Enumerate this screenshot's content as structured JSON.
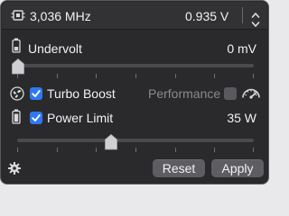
{
  "header": {
    "frequency": "3,036 MHz",
    "voltage": "0.935 V",
    "icons": [
      "cpu-chip-icon",
      "chevron-up-icon",
      "chevron-down-icon"
    ]
  },
  "undervolt": {
    "label": "Undervolt",
    "value": "0 mV",
    "icon": "battery-icon",
    "slider_level": 0.0
  },
  "turbo": {
    "label": "Turbo Boost",
    "checked": true,
    "mode_label": "Performance",
    "mode_checked": false,
    "icons": [
      "turbo-fan-icon",
      "speedometer-icon"
    ]
  },
  "power": {
    "label": "Power Limit",
    "value": "35 W",
    "checked": true,
    "icon": "battery-icon",
    "slider_level": 0.4
  },
  "footer": {
    "reset_label": "Reset",
    "apply_label": "Apply",
    "settings_icon": "gear-icon"
  },
  "colors": {
    "background": "#2a2a2c",
    "accent": "#2f78f0",
    "button": "#5d5d62"
  }
}
